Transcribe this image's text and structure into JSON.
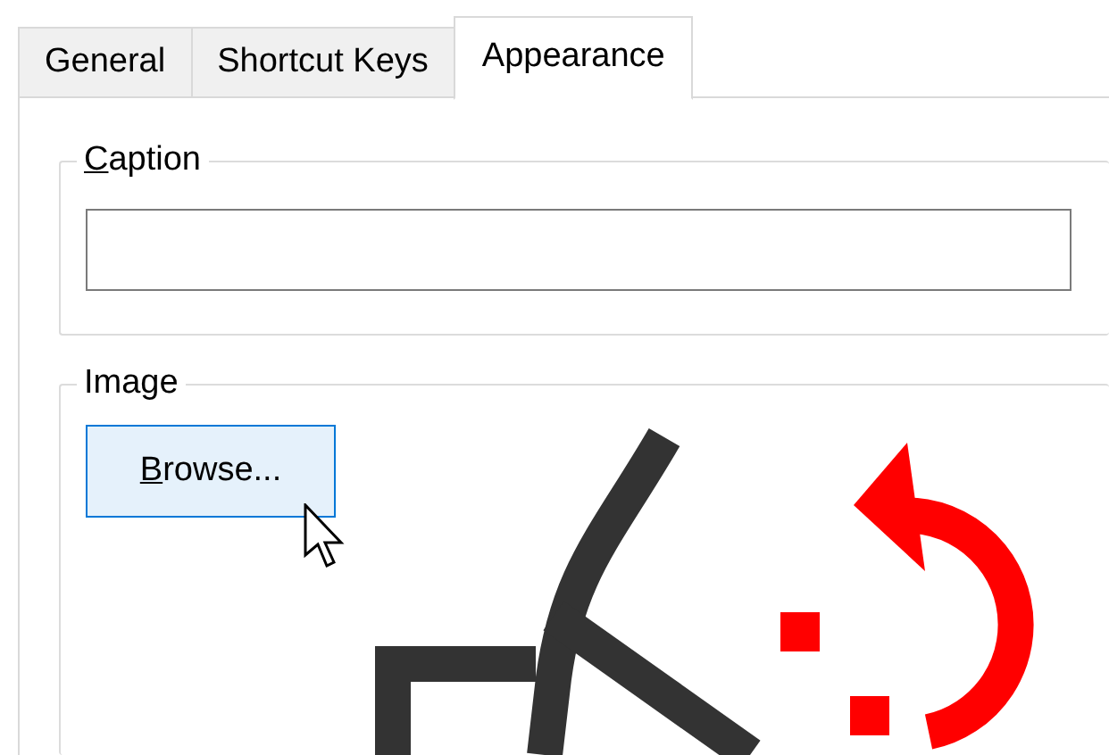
{
  "tabs": [
    {
      "label": "General",
      "selected": false
    },
    {
      "label": "Shortcut Keys",
      "selected": false
    },
    {
      "label": "Appearance",
      "selected": true
    }
  ],
  "caption_group": {
    "title": "Caption",
    "access_key_underlined": true
  },
  "image_group": {
    "title": "Image",
    "browse_button": {
      "label": "Browse...",
      "access_key_underlined": true,
      "hovered": true
    }
  }
}
